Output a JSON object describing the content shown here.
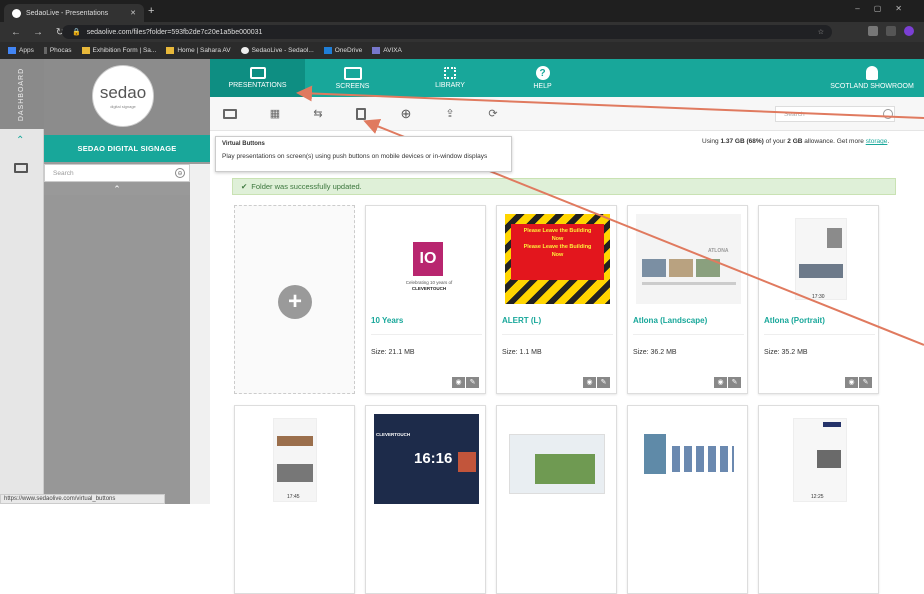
{
  "browser": {
    "tab_title": "SedaoLive - Presentations",
    "url": "sedaolive.com/files?folder=593fb2de7c20e1a5be000031",
    "bookmarks": [
      "Apps",
      "Phocas",
      "Exhibition Form | Sa...",
      "Home | Sahara AV",
      "SedaoLive - Sedaol...",
      "OneDrive",
      "AVIXA"
    ],
    "status_url": "https://www.sedaolive.com/virtual_buttons"
  },
  "left": {
    "dashboard_label": "DASHBOARD",
    "logo_text": "sedao",
    "logo_sub": "digital signage",
    "signage_title": "SEDAO DIGITAL SIGNAGE",
    "search_placeholder": "Search"
  },
  "topnav": {
    "presentations": "PRESENTATIONS",
    "screens": "SCREENS",
    "library": "LIBRARY",
    "help": "HELP",
    "account": "SCOTLAND SHOWROOM"
  },
  "toolbar": {
    "search_placeholder": "Search"
  },
  "tooltip": {
    "title": "Virtual Buttons",
    "body": "Play presentations on screen(s) using push buttons on mobile devices or in-window displays"
  },
  "usage": {
    "prefix": "Using ",
    "used": "1.37 GB (68%)",
    "mid": " of your ",
    "total": "2 GB",
    "suffix": " allowance. Get more ",
    "link": "storage"
  },
  "alert": {
    "message": "Folder was successfully updated."
  },
  "cards": [
    {
      "name": "10 Years",
      "size": "Size: 21.1 MB"
    },
    {
      "name": "ALERT (L)",
      "size": "Size: 1.1 MB"
    },
    {
      "name": "Atlona (Landscape)",
      "size": "Size: 36.2 MB"
    },
    {
      "name": "Atlona (Portrait)",
      "size": "Size: 35.2 MB"
    }
  ],
  "thumb_text": {
    "tenyears_caption": "Celebrating 10 years of",
    "tenyears_brand": "CLEVERTOUCH",
    "alert_line1": "Please Leave the Building",
    "alert_line2": "Now",
    "alert_line3": "Please Leave the Building",
    "alert_line4": "Now",
    "atlona": "ATLONA",
    "clevertouch_row2": "CLEVERTOUCH",
    "clock": "16:16",
    "time1": "17:45",
    "time2": "12:25",
    "time3": "17:30"
  }
}
